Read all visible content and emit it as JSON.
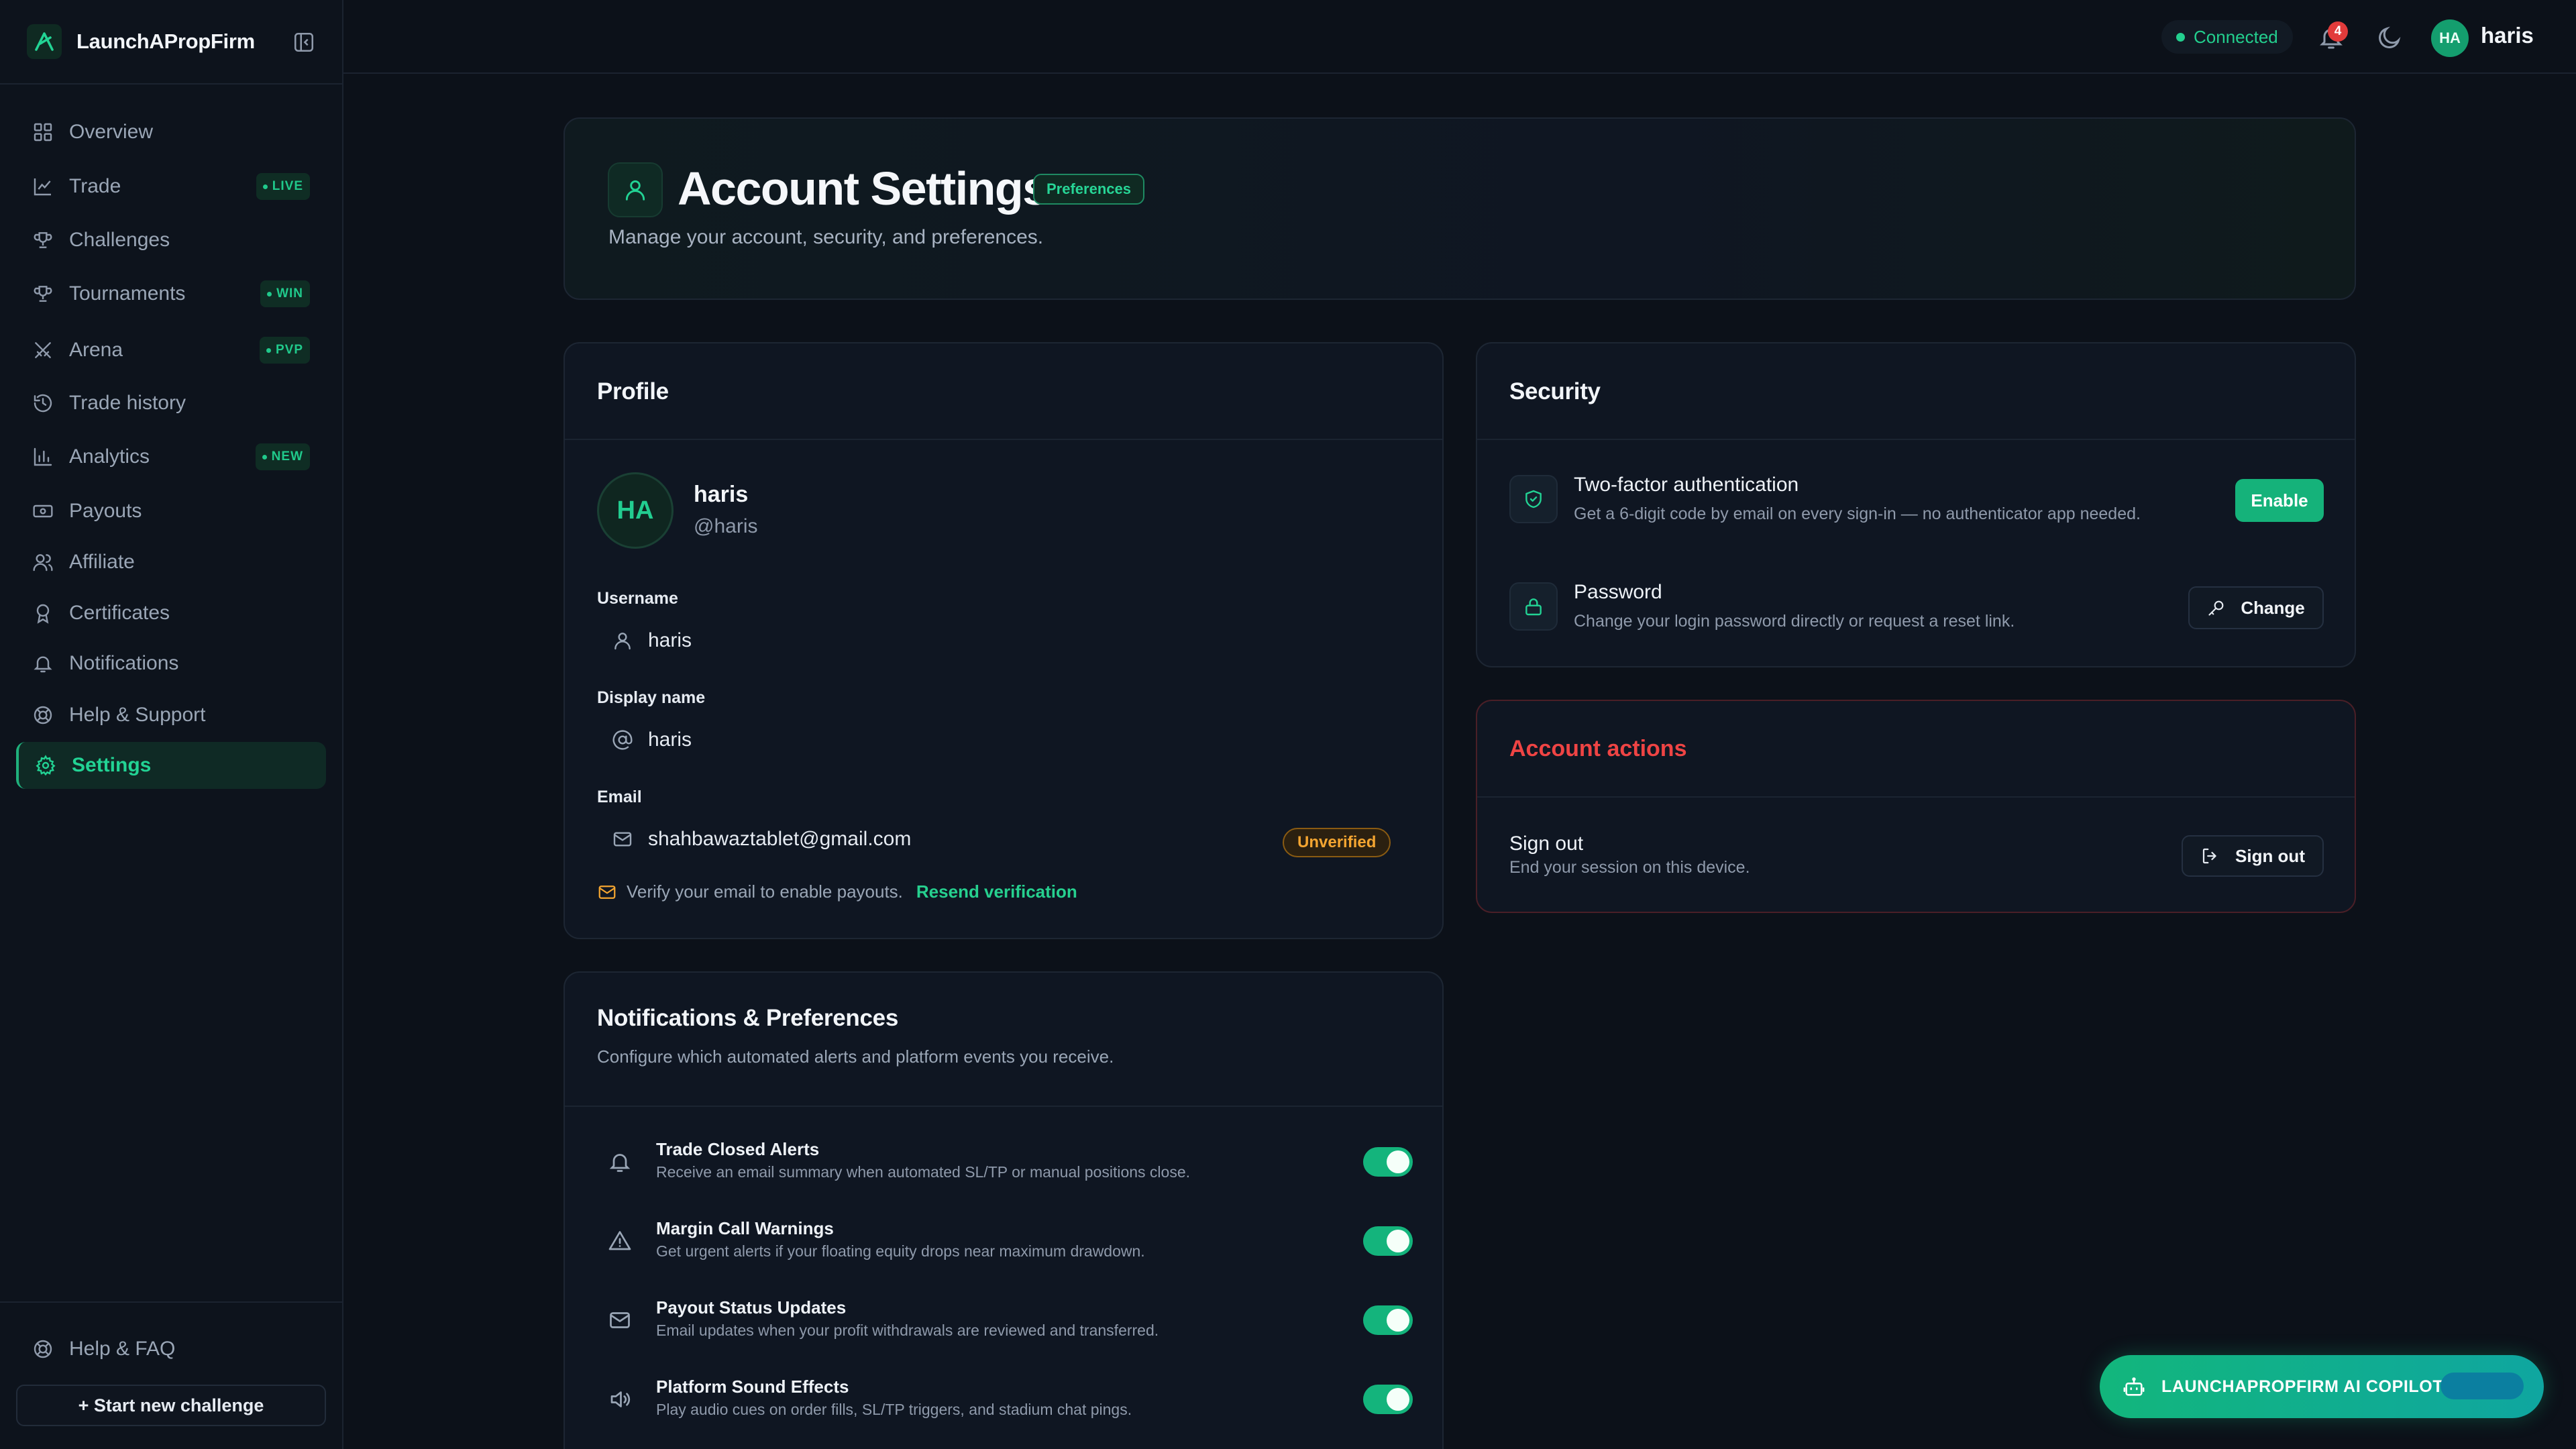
{
  "brand": {
    "name": "LaunchAPropFirm"
  },
  "sidebar": {
    "items": [
      {
        "label": "Overview",
        "icon": "grid-icon",
        "badge": ""
      },
      {
        "label": "Trade",
        "icon": "chart-icon",
        "badge": "LIVE"
      },
      {
        "label": "Challenges",
        "icon": "trophy-icon",
        "badge": ""
      },
      {
        "label": "Tournaments",
        "icon": "trophy-icon",
        "badge": "WIN"
      },
      {
        "label": "Arena",
        "icon": "swords-icon",
        "badge": "PVP"
      },
      {
        "label": "Trade history",
        "icon": "history-icon",
        "badge": ""
      },
      {
        "label": "Analytics",
        "icon": "bar-chart-icon",
        "badge": "NEW"
      },
      {
        "label": "Payouts",
        "icon": "banknote-icon",
        "badge": ""
      },
      {
        "label": "Affiliate",
        "icon": "users-icon",
        "badge": ""
      },
      {
        "label": "Certificates",
        "icon": "award-icon",
        "badge": ""
      },
      {
        "label": "Notifications",
        "icon": "bell-icon",
        "badge": ""
      },
      {
        "label": "Help & Support",
        "icon": "lifebuoy-icon",
        "badge": ""
      },
      {
        "label": "Settings",
        "icon": "gear-icon",
        "badge": ""
      }
    ],
    "help_faq": "Help & FAQ",
    "new_challenge": "+ Start new challenge"
  },
  "topbar": {
    "status": "Connected",
    "notification_count": "4",
    "avatar_initials": "HA",
    "username": "haris"
  },
  "hero": {
    "title": "Account Settings",
    "badge": "Preferences",
    "subtitle": "Manage your account, security, and preferences."
  },
  "profile": {
    "title": "Profile",
    "avatar_initials": "HA",
    "name": "haris",
    "handle": "@haris",
    "username_label": "Username",
    "username_value": "haris",
    "display_name_label": "Display name",
    "display_name_value": "haris",
    "email_label": "Email",
    "email_value": "shahbawaztablet@gmail.com",
    "email_status": "Unverified",
    "verify_text": "Verify your email to enable payouts.",
    "resend_link": "Resend verification"
  },
  "notifications": {
    "title": "Notifications & Preferences",
    "subtitle": "Configure which automated alerts and platform events you receive.",
    "items": [
      {
        "title": "Trade Closed Alerts",
        "desc": "Receive an email summary when automated SL/TP or manual positions close.",
        "enabled": true
      },
      {
        "title": "Margin Call Warnings",
        "desc": "Get urgent alerts if your floating equity drops near maximum drawdown.",
        "enabled": true
      },
      {
        "title": "Payout Status Updates",
        "desc": "Email updates when your profit withdrawals are reviewed and transferred.",
        "enabled": true
      },
      {
        "title": "Platform Sound Effects",
        "desc": "Play audio cues on order fills, SL/TP triggers, and stadium chat pings.",
        "enabled": true
      }
    ]
  },
  "security": {
    "title": "Security",
    "twofa_title": "Two-factor authentication",
    "twofa_desc": "Get a 6-digit code by email on every sign-in — no authenticator app needed.",
    "twofa_button": "Enable",
    "password_title": "Password",
    "password_desc": "Change your login password directly or request a reset link.",
    "password_button": "Change"
  },
  "account_actions": {
    "title": "Account actions",
    "signout_title": "Sign out",
    "signout_desc": "End your session on this device.",
    "signout_button": "Sign out"
  },
  "copilot": {
    "label": "LAUNCHAPROPFIRM AI COPILOT"
  },
  "colors": {
    "accent": "#14b47c",
    "danger": "#ef4444",
    "warning": "#f4a531",
    "background": "#0c1119"
  }
}
